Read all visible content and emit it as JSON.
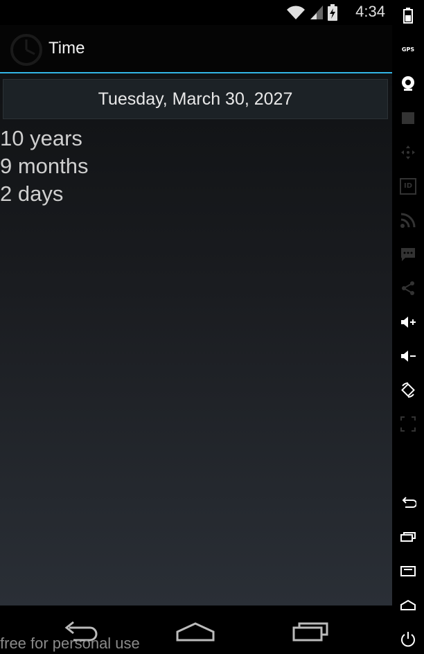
{
  "status_bar": {
    "time": "4:34"
  },
  "action_bar": {
    "title": "Time"
  },
  "main": {
    "date_label": "Tuesday, March 30, 2027",
    "elapsed": [
      "10 years",
      "9 months",
      "2 days"
    ]
  },
  "footer": {
    "watermark": "free for personal use"
  },
  "side_toolbar": {
    "gps_label": "GPS",
    "id_label": "ID"
  },
  "colors": {
    "accent": "#33b5e5",
    "background": "#000000"
  }
}
